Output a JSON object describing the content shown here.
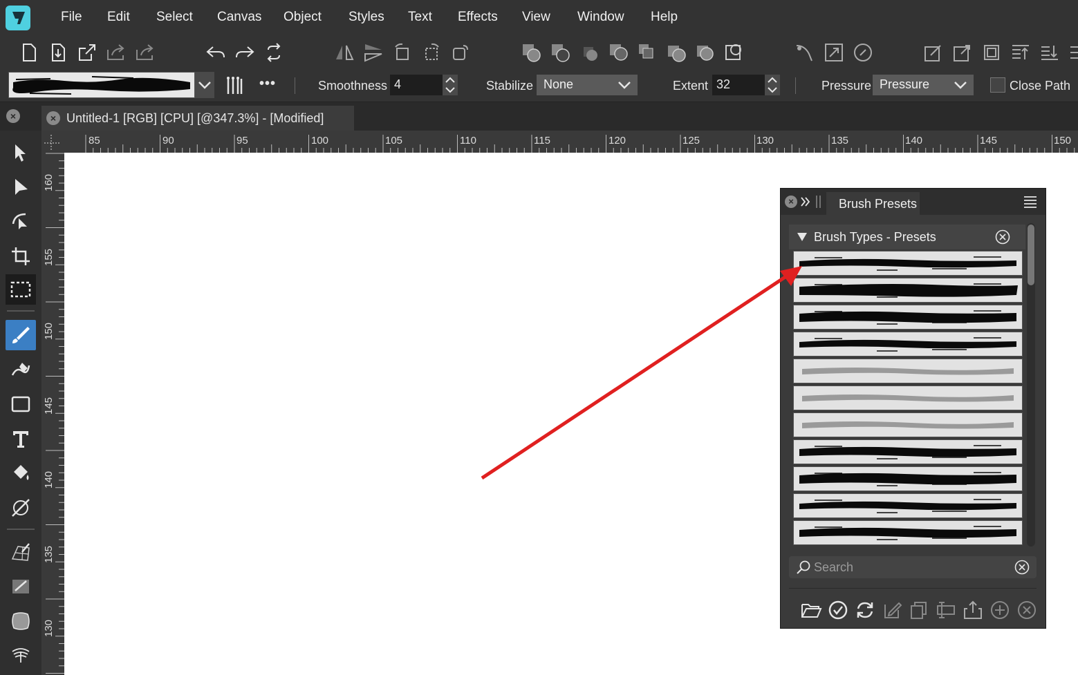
{
  "menu": [
    "File",
    "Edit",
    "Select",
    "Canvas",
    "Object",
    "Styles",
    "Text",
    "Effects",
    "View",
    "Window",
    "Help"
  ],
  "context": {
    "smoothness_label": "Smoothness",
    "smoothness_value": "4",
    "stabilize_label": "Stabilize",
    "stabilize_value": "None",
    "extent_label": "Extent",
    "extent_value": "32",
    "pressure_label": "Pressure",
    "pressure_value": "Pressure",
    "close_path_label": "Close Path",
    "more_icon": "•••"
  },
  "document": {
    "tab_title": "Untitled-1 [RGB] [CPU] [@347.3%] - [Modified]"
  },
  "ruler": {
    "horizontal": [
      "85",
      "90",
      "95",
      "100",
      "105",
      "110",
      "115",
      "120",
      "125",
      "130",
      "135",
      "140",
      "145",
      "150"
    ],
    "vertical": [
      "160",
      "155",
      "150",
      "145",
      "140",
      "135",
      "130"
    ]
  },
  "panel": {
    "tab": "Brush Presets",
    "section": "Brush Types - Presets",
    "search_placeholder": "Search",
    "preset_count": 11
  },
  "colors": {
    "accent": "#3b7fc4",
    "logo": "#4fd0e0",
    "arrow": "#e02020"
  }
}
